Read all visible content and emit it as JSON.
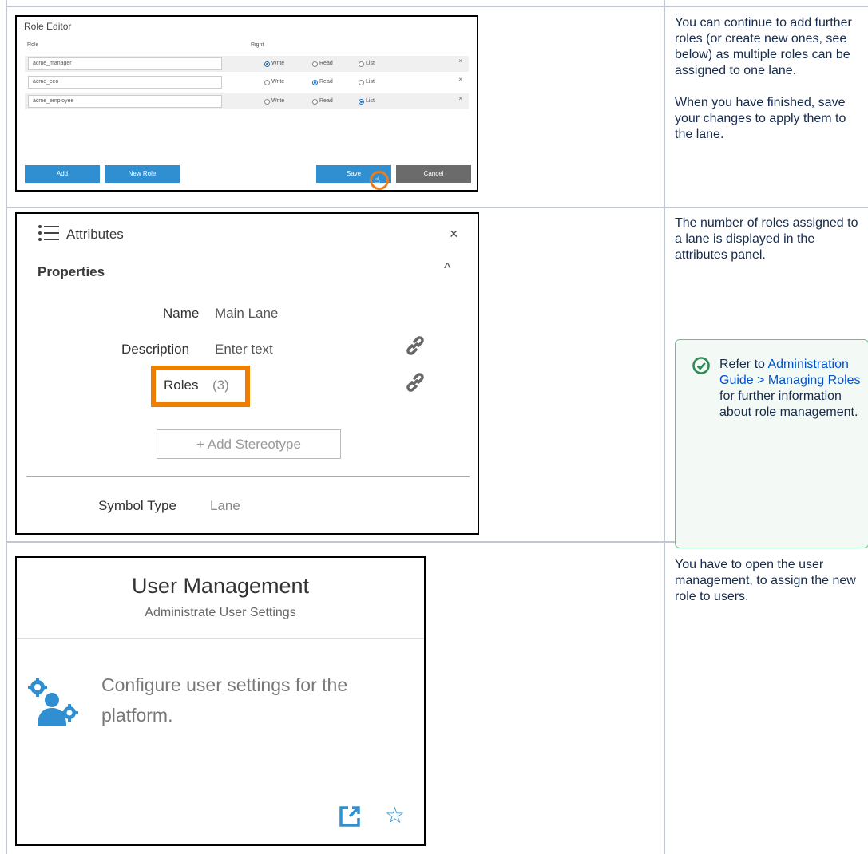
{
  "role_editor": {
    "title": "Role Editor",
    "col_role": "Role",
    "col_right": "Right",
    "rows": [
      {
        "role": "acme_manager",
        "write": "Write",
        "read": "Read",
        "list": "List",
        "selected": "write"
      },
      {
        "role": "acme_ceo",
        "write": "Write",
        "read": "Read",
        "list": "List",
        "selected": "read"
      },
      {
        "role": "acme_employee",
        "write": "Write",
        "read": "Read",
        "list": "List",
        "selected": "list"
      }
    ],
    "remove_symbol": "×",
    "buttons": {
      "add": "Add",
      "new_role": "New Role",
      "save": "Save",
      "cancel": "Cancel"
    },
    "accent_color": "#2f8fd1"
  },
  "notes": {
    "note1_p1": "You can continue to add further roles (or create new ones, see below) as multiple roles can be assigned to one lane.",
    "note1_p2": "When you have finished, save your changes to apply them to the lane.",
    "note2": "The number of roles assigned to a lane is displayed in the attributes panel.",
    "note3": "You have to open the user management, to assign the new role to users."
  },
  "attributes": {
    "title": "Attributes",
    "close": "×",
    "section": "Properties",
    "collapse": "^",
    "name_label": "Name",
    "name_value": "Main Lane",
    "description_label": "Description",
    "description_value": "Enter text",
    "roles_label": "Roles",
    "roles_value": "(3)",
    "add_stereotype": "+ Add Stereotype",
    "symbol_type_label": "Symbol Type",
    "symbol_type_value": "Lane",
    "highlight_color": "#ef7d00"
  },
  "user_management": {
    "title": "User Management",
    "subtitle": "Administrate User Settings",
    "description": "Configure user settings for the platform."
  },
  "info_panel": {
    "text_prefix": "Refer to ",
    "link": "Administration Guide > Managing Roles",
    "text_suffix": " for further information about role management.",
    "accent_color": "#6bc089"
  },
  "icons": [
    "list-icon",
    "close-icon",
    "chevron-up-icon",
    "link-icon",
    "users-gear-icon",
    "open-external-icon",
    "star-icon",
    "check-circle-icon",
    "pointer-hand-icon"
  ]
}
